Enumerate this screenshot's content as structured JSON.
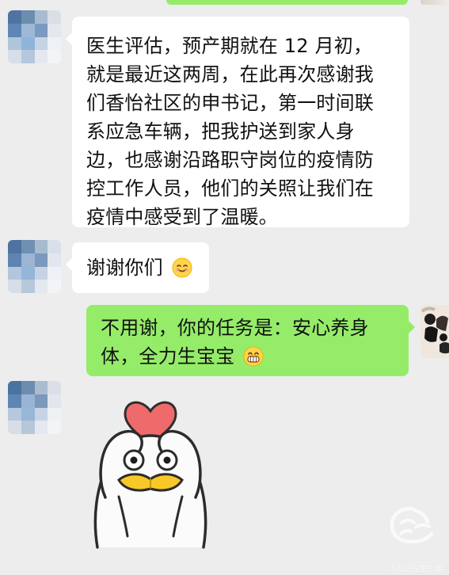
{
  "messages": [
    {
      "text": "医生评估，预产期就在 12 月初，就是最近这两周，在此再次感谢我们香怡社区的申书记，第一时间联系应急车辆，把我护送到家人身边，也感谢沿路职守岗位的疫情防控工作人员，他们的关照让我们在疫情中感受到了温暖。",
      "lines": [
        "医生评估，预产期就在 12 月初，",
        "就是最近这两周，在此再次感谢我",
        "们香怡社区的申书记，第一时间联",
        "系应急车辆，把我护送到家人身",
        "边，也感谢沿路职守岗位的疫情防",
        "控工作人员，他们的关照让我们在",
        "疫情中感受到了温暖。"
      ]
    },
    {
      "text": "谢谢你们",
      "emoji": "smile-icon"
    },
    {
      "text": "不用谢，你的任务是：安心养身体，全力生宝宝",
      "lines": [
        "不用谢，你的任务是：安心养身",
        "体，全力生宝宝"
      ],
      "emoji": "grin-icon"
    }
  ],
  "sticker": {
    "name": "duck-heart-sticker"
  },
  "watermark": {
    "text": "人民日报客户端"
  },
  "colors": {
    "background": "#ededed",
    "white_bubble": "#ffffff",
    "green_bubble": "#95ec69",
    "text": "#111111",
    "accent_red": "#e96b6b",
    "accent_yellow": "#f7c928"
  }
}
